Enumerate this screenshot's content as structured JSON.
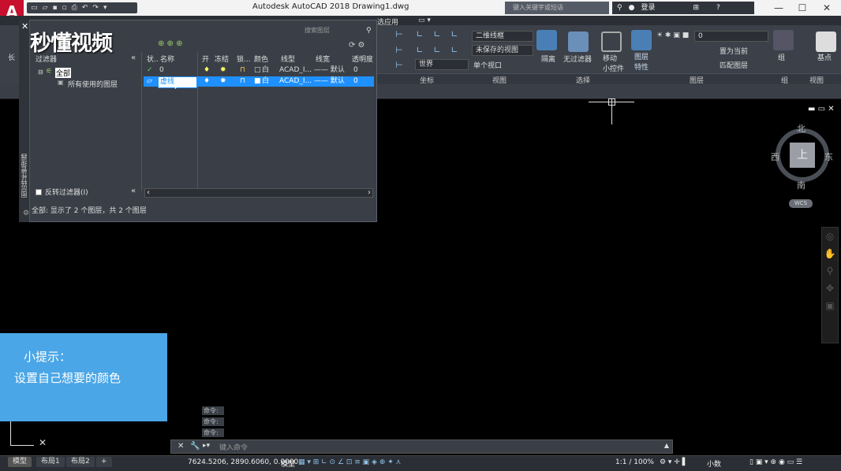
{
  "app": {
    "logo": "A",
    "title": "Autodesk AutoCAD 2018    Drawing1.dwg",
    "search_placeholder": "键入关键字或短语",
    "login": "登录",
    "help": "?"
  },
  "window_controls": {
    "minimize": "—",
    "maximize": "☐",
    "close": "✕"
  },
  "ribbon": {
    "tab_fragment": "选应用",
    "left_label": "长",
    "visual_style": "二维线框",
    "saved_view": "未保存的视图",
    "ucs": "世界",
    "viewport": "单个视口",
    "isolate": "隔离",
    "no_filter": "无过滤器",
    "move_gizmo": "移动\n小控件",
    "layer_properties": "图层\n特性",
    "layer_current": "0",
    "set_current": "置为当前",
    "match_layer": "匹配图层",
    "group": "组",
    "base_point": "基点",
    "panels": {
      "coords": "坐标",
      "view": "视图",
      "selection": "选择",
      "layers": "图层",
      "groups": "组",
      "view2": "视图"
    }
  },
  "watermark": "秒懂视频",
  "layer_manager": {
    "side_title": "图层特性管理器",
    "close": "✕",
    "search_placeholder": "搜索图层",
    "filters_header": "过滤器",
    "filter_tree": [
      "全部",
      "所有使用的图层"
    ],
    "invert_filter": "反转过滤器(I)",
    "columns": [
      "状..",
      "名称",
      "开",
      "冻结",
      "锁...",
      "颜色",
      "线型",
      "线宽",
      "透明度"
    ],
    "rows": [
      {
        "name": "0",
        "color": "白",
        "linetype": "ACAD_I...",
        "lineweight": "—— 默认",
        "transparency": "0",
        "selected": false
      },
      {
        "name": "虚线",
        "color": "白",
        "linetype": "ACAD_I...",
        "lineweight": "—— 默认",
        "transparency": "0",
        "selected": true
      }
    ],
    "status": "全部: 显示了 2 个图层，共 2 个图层"
  },
  "viewcube": {
    "north": "北",
    "south": "南",
    "east": "东",
    "west": "西",
    "top": "上",
    "wcs": "WCS"
  },
  "tip": {
    "title": "小提示：",
    "text": "设置自己想要的颜色"
  },
  "command": {
    "history": [
      "命令:",
      "命令:",
      "命令:"
    ],
    "placeholder": "键入命令"
  },
  "status_bar": {
    "tabs": [
      "模型",
      "布局1",
      "布局2",
      "+"
    ],
    "coords": "7624.5206, 2890.6060, 0.0000",
    "model": "模型",
    "scale": "1:1 / 100%",
    "units": "小数"
  },
  "colors": {
    "accent": "#4aa6e6",
    "selection": "#1e90ff",
    "ribbon_bg": "#3b4049"
  }
}
